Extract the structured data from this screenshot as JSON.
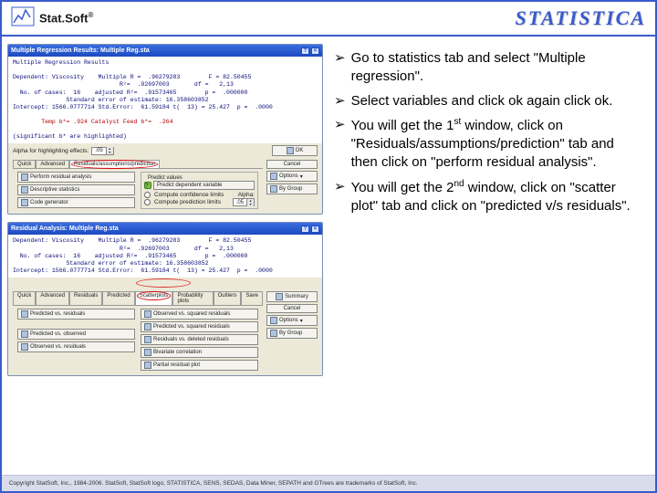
{
  "header": {
    "logo_text": "Stat.Soft",
    "logo_reg": "®",
    "brand_right": "STATISTICA"
  },
  "window1": {
    "title": "Multiple Regression Results: Multiple Reg.sta",
    "section": "Multiple Regression Results",
    "stats_line1": "Dependent: Viscosity    Multiple R =  .96279283        F = 82.50455",
    "stats_line2": "                              R²=  .92697003       df =   2,13",
    "stats_line3": "  No. of cases:  16    adjusted R²=  .91573465        p =  .000000",
    "stats_line4": "               Standard error of estimate: 16.358603852",
    "stats_line5": "Intercept: 1566.0777714 Std.Error:  61.59184 t(  13) = 25.427  p =  .0000",
    "stats_line6": "        Temp b*= .924 Catalyst Feed b*=  .264",
    "stats_sig": "(significant b* are highlighted)",
    "alpha_label": "Alpha for highlighting effects:",
    "alpha_value": ".05",
    "tabs": {
      "quick": "Quick",
      "advanced": "Advanced",
      "residuals": "Residuals/assumptions/prediction"
    },
    "buttons": {
      "residual_analysis": "Perform residual analysis",
      "descriptive": "Descriptive statistics",
      "codegen": "Code generator",
      "predict_label": "Predict values",
      "predict_dep": "Predict dependent variable",
      "conf_limits": "Compute confidence limits",
      "pred_limits": "Compute prediction limits",
      "alpha2": "Alpha:",
      "alpha2_value": ".05",
      "ok": "OK",
      "cancel": "Cancel",
      "options": "Options",
      "bygroup": "By Group"
    }
  },
  "window2": {
    "title": "Residual Analysis: Multiple Reg.sta",
    "tabs": {
      "quick": "Quick",
      "advanced": "Advanced",
      "residuals": "Residuals",
      "predicted": "Predicted",
      "scatterplots": "Scatterplots",
      "probability": "Probability plots",
      "outliers": "Outliers",
      "save": "Save"
    },
    "buttons": {
      "pred_vs_resid": "Predicted vs. residuals",
      "pred_vs_sq_resid": "Predicted vs. squared residuals",
      "pred_vs_obs": "Predicted vs. observed",
      "obs_vs_sq_resid": "Observed vs. squared residuals",
      "resid_vs_del": "Residuals vs. deleted residuals",
      "obs_vs_resid": "Observed vs. residuals",
      "biv_corr": "Bivariate correlation",
      "partial": "Partial residual plot",
      "summary": "Summary",
      "cancel": "Cancel",
      "options": "Options",
      "bygroup": "By Group"
    }
  },
  "instructions": {
    "i1a": "Go to statistics tab and select \"Multiple regression\".",
    "i2a": "Select variables and click ok again click ok.",
    "i3a": "You will get the 1",
    "i3sup": "st",
    "i3b": " window, click on \"Residuals/assumptions/prediction\" tab and then click on \"perform residual analysis\".",
    "i4a": "You will get the 2",
    "i4sup": "nd",
    "i4b": " window, click on \"scatter plot\" tab and click on \"predicted v/s residuals\"."
  },
  "footer": {
    "text": "Copyright StatSoft, Inc., 1984-2006. StatSoft, StatSoft logo, STATISTICA, SENS, SEDAS, Data Miner, SEPATH and GTrees are trademarks of StatSoft, Inc."
  }
}
